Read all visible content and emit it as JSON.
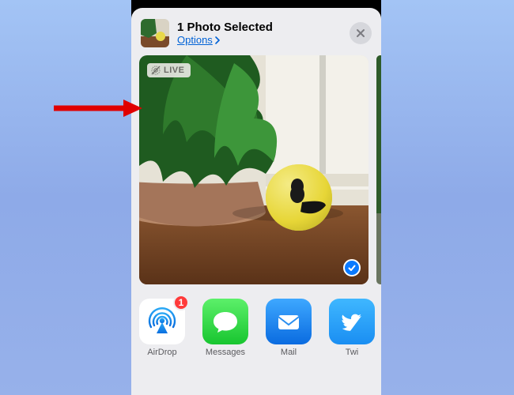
{
  "header": {
    "title": "1 Photo Selected",
    "options_label": "Options"
  },
  "live_badge": {
    "text": "LIVE"
  },
  "airdrop_badge_count": "1",
  "apps": [
    {
      "label": "AirDrop"
    },
    {
      "label": "Messages"
    },
    {
      "label": "Mail"
    },
    {
      "label": "Twi"
    }
  ]
}
